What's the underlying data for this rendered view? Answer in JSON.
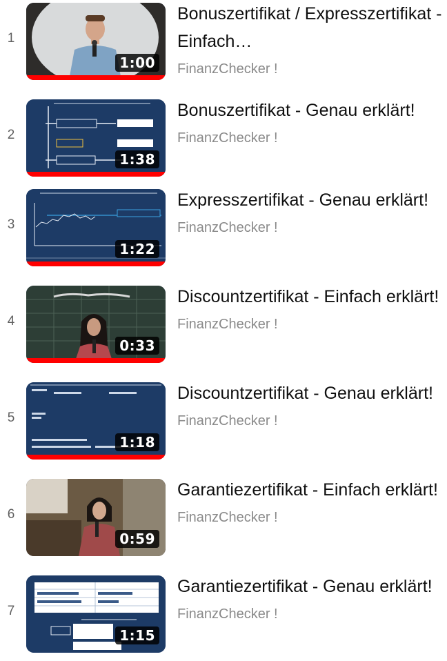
{
  "playlist": {
    "items": [
      {
        "index": "1",
        "title": "Bonuszertifikat / Expresszertifikat - Einfach…",
        "channel": "FinanzChecker !",
        "duration": "1:00",
        "watched_fraction": 1.0,
        "thumbnail": "man-speaking-microphone"
      },
      {
        "index": "2",
        "title": "Bonuszertifikat - Genau erklärt!",
        "channel": "FinanzChecker !",
        "duration": "1:38",
        "watched_fraction": 1.0,
        "thumbnail": "bonus-diagram-slide"
      },
      {
        "index": "3",
        "title": "Expresszertifikat - Genau erklärt!",
        "channel": "FinanzChecker !",
        "duration": "1:22",
        "watched_fraction": 1.0,
        "thumbnail": "express-line-chart-slide"
      },
      {
        "index": "4",
        "title": "Discountzertifikat - Einfach erklärt!",
        "channel": "FinanzChecker !",
        "duration": "0:33",
        "watched_fraction": 1.0,
        "thumbnail": "woman-chalkboard"
      },
      {
        "index": "5",
        "title": "Discountzertifikat - Genau erklärt!",
        "channel": "FinanzChecker !",
        "duration": "1:18",
        "watched_fraction": 1.0,
        "thumbnail": "discount-text-slide"
      },
      {
        "index": "6",
        "title": "Garantiezertifikat - Einfach erklärt!",
        "channel": "FinanzChecker !",
        "duration": "0:59",
        "watched_fraction": 0.0,
        "thumbnail": "woman-classroom"
      },
      {
        "index": "7",
        "title": "Garantiezertifikat - Genau erklärt!",
        "channel": "FinanzChecker !",
        "duration": "1:15",
        "watched_fraction": 0.0,
        "thumbnail": "garantie-table-slide"
      }
    ]
  },
  "colors": {
    "progress": "#ff0000",
    "slide_bg": "#1d3b66",
    "title": "#0f0f0f",
    "channel": "#8a8a8a",
    "index": "#606060"
  }
}
